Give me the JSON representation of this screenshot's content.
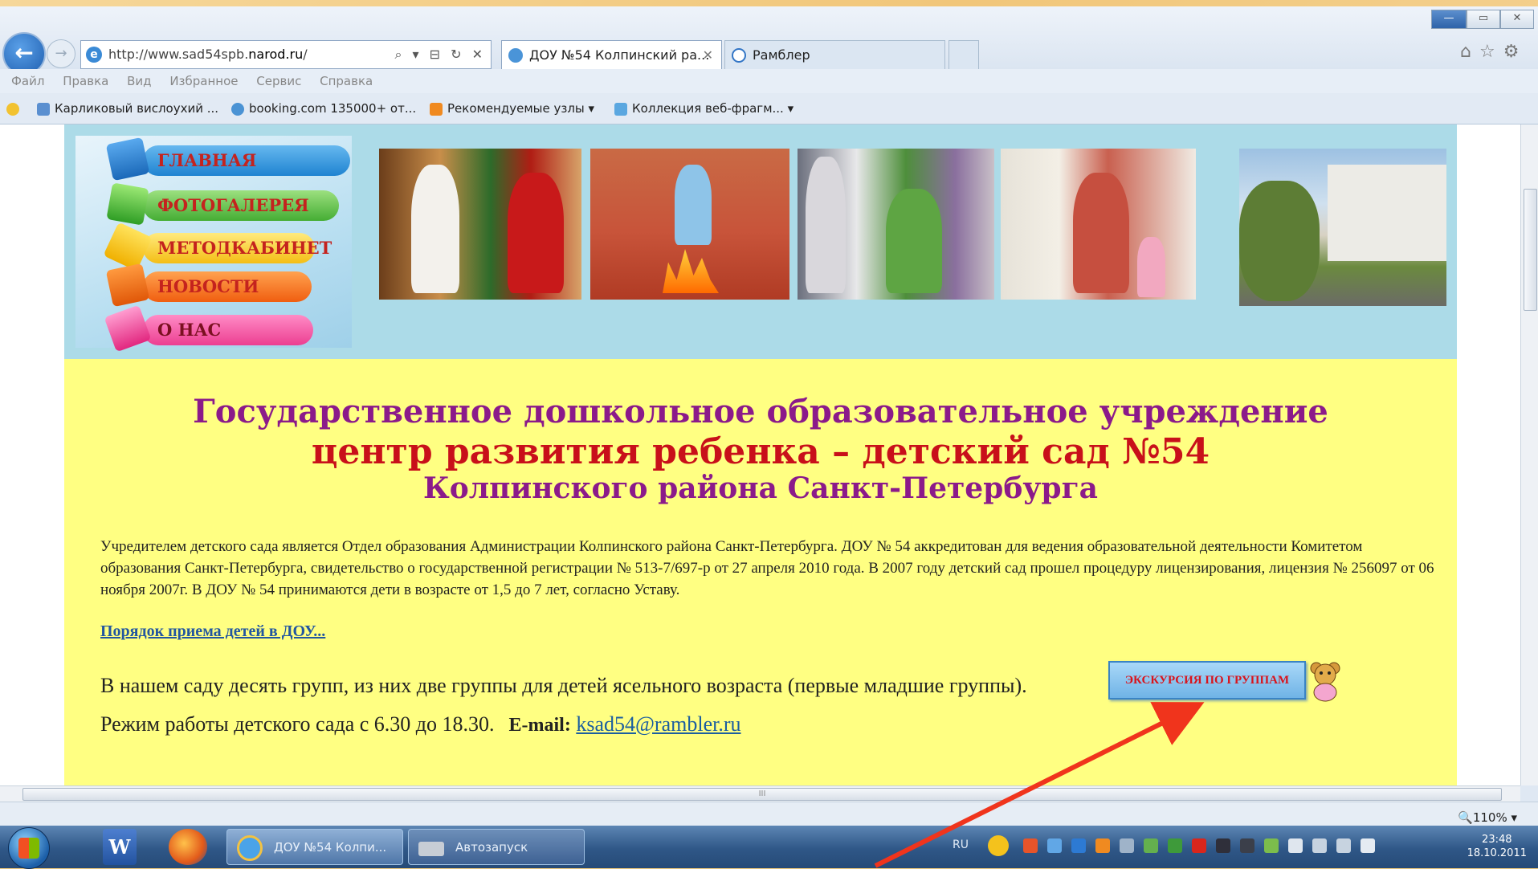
{
  "browser": {
    "url_prefix": "http://www.sad54spb.",
    "url_bold": "narod.ru",
    "url_suffix": "/",
    "address_controls": "⌕ ▾ ⊟ ↻ ✕",
    "tabs": [
      {
        "label": "ДОУ №54 Колпинский ра...",
        "close": "✕"
      },
      {
        "label": "Рамблер"
      }
    ],
    "window_controls": {
      "minimize": "—",
      "maximize": "▭",
      "close": "✕"
    },
    "right_icons": "⌂☆⚙",
    "menu": [
      "Файл",
      "Правка",
      "Вид",
      "Избранное",
      "Сервис",
      "Справка"
    ],
    "favorites": [
      {
        "label": "Карликовый вислоухий ...",
        "color": "#5a8fd0"
      },
      {
        "label": "booking.com 135000+ от...",
        "color": "#4b93d4"
      },
      {
        "label": "Рекомендуемые узлы ▾",
        "color": "#f08a20"
      },
      {
        "label": "Коллекция веб-фрагм... ▾",
        "color": "#5aa7e0"
      }
    ],
    "zoom": "🔍110%  ▾",
    "hscroll_grip": "III"
  },
  "site": {
    "menu": [
      "ГЛАВНАЯ",
      "ФОТОГАЛЕРЕЯ",
      "МЕТОДКАБИНЕТ",
      "НОВОСТИ",
      "О НАС"
    ],
    "title_line1": "Государственное дошкольное образовательное учреждение",
    "title_line2": "центр развития ребенка – детский сад №54",
    "title_line3": "Колпинского района Санкт-Петербурга",
    "paragraph": "Учредителем детского сада является Отдел образования Администрации Колпинского района Санкт-Петербурга. ДОУ № 54 аккредитован для ведения образовательной деятельности Комитетом образования Санкт-Петербурга, свидетельство о государственной регистрации № 513-7/697-р от 27 апреля 2010 года. В 2007 году детский сад прошел процедуру лицензирования, лицензия № 256097 от 06 ноября 2007г. В ДОУ № 54 принимаются дети в возрасте от 1,5 до 7 лет, согласно Уставу.",
    "admission_link": "Порядок приема детей в ДОУ...",
    "groups_text": "В нашем саду десять групп, из них две группы для детей ясельного возраста (первые младшие группы).",
    "excursion_button": "ЭКСКУРСИЯ ПО ГРУППАМ",
    "hours_text": "Режим работы детского сада с 6.30 до 18.30.",
    "email_label": "E-mail:",
    "email": "ksad54@rambler.ru"
  },
  "taskbar": {
    "word_icon": "W",
    "tasks": [
      "ДОУ №54 Колпи...",
      "Автозапуск"
    ],
    "lang": "RU",
    "time": "23:48",
    "date": "18.10.2011"
  },
  "colors": {
    "banner": "#acdbe8",
    "content_bg": "#ffff82",
    "title_purple": "#8b1a8a",
    "title_red": "#c8101a",
    "arrow": "#f0341c"
  }
}
